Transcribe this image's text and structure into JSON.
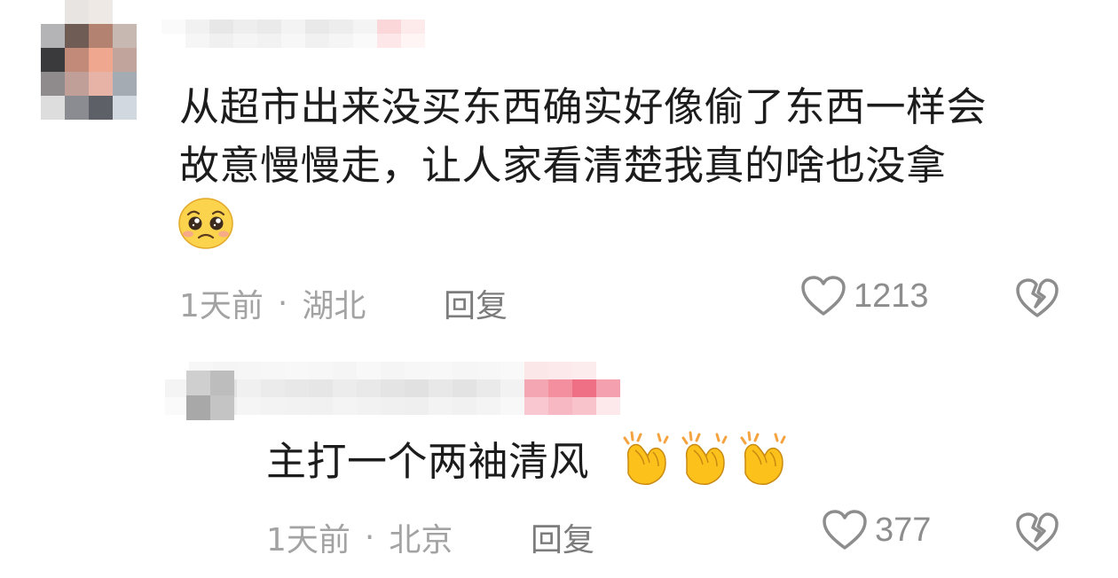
{
  "comments": [
    {
      "text_line1": "从超市出来没买东西确实好像偷了东西一样会",
      "text_line2": "故意慢慢走，让人家看清楚我真的啥也没拿",
      "emoji": "pleading-face",
      "time": "1天前",
      "dot": "·",
      "location": "湖北",
      "reply_label": "回复",
      "likes": "1213"
    },
    {
      "text": "主打一个两袖清风",
      "emojis": [
        "clapping-hands",
        "clapping-hands",
        "clapping-hands"
      ],
      "time": "1天前",
      "dot": "·",
      "location": "北京",
      "reply_label": "回复",
      "likes": "377"
    }
  ],
  "colors": {
    "text": "#1c1c1c",
    "meta": "#a3a3a3",
    "reply": "#7c7c7c",
    "icon": "#8d8d8d"
  }
}
